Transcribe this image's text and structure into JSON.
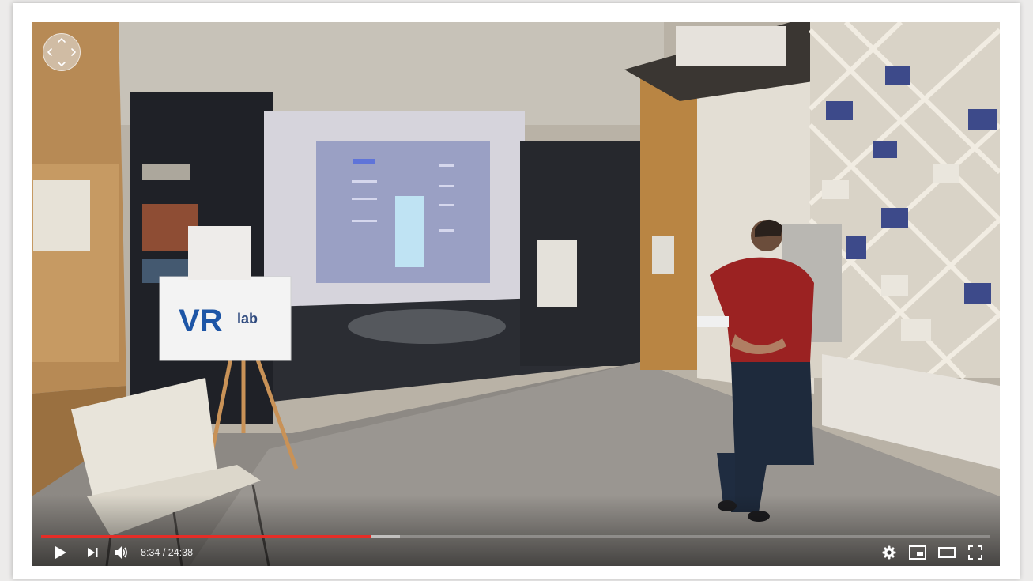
{
  "player": {
    "time": {
      "current": "8:34",
      "duration": "24:38",
      "separator": " / "
    },
    "progress": {
      "played_fraction": 0.348,
      "buffered_fraction": 0.378
    },
    "scene": {
      "banner_text_main": "VR",
      "banner_text_sub": "lab"
    },
    "controls": {
      "play_icon": "play-icon",
      "next_icon": "next-icon",
      "volume_icon": "volume-icon",
      "settings_icon": "gear-icon",
      "miniplayer_icon": "miniplayer-icon",
      "theater_icon": "theater-mode-icon",
      "fullscreen_icon": "fullscreen-icon",
      "pan_icon": "360-pan-icon"
    },
    "colors": {
      "progress_played": "#e52d27",
      "controls": "#ffffff"
    }
  }
}
